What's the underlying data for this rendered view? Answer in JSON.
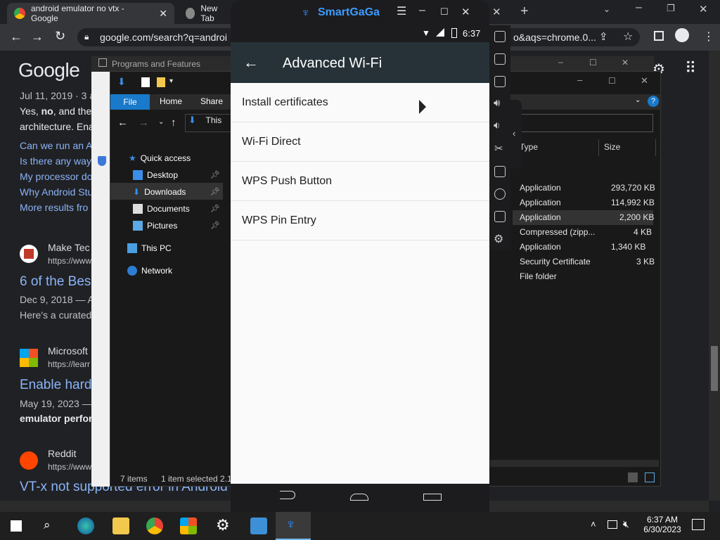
{
  "chrome": {
    "tabs": [
      {
        "label": "android emulator no vtx - Google"
      },
      {
        "label": "New Tab"
      }
    ],
    "url": "google.com/search?q=androi",
    "url_tail": "o&aqs=chrome.0..."
  },
  "google": {
    "logo": "Google",
    "date1": "Jul 11, 2019 · 3 a",
    "snippet_a": "Yes, ",
    "snippet_bold": "no",
    "snippet_b": ", and ther",
    "snippet2": "architecture. Ena",
    "links": [
      "Can we run an A",
      "Is there any way",
      "My processor do",
      "Why Android Stu",
      "More results fro"
    ],
    "results": [
      {
        "site": "Make Tec",
        "url": "https://www",
        "title": "6 of the Bes",
        "date": "Dec 9, 2018 — A",
        "snippet": "Here's a curated"
      },
      {
        "site": "Microsoft",
        "url": "https://learr",
        "title": "Enable hard",
        "date": "May 19, 2023 —",
        "snippet": "emulator perform"
      },
      {
        "site": "Reddit",
        "url": "https://www.re",
        "title": "VT-x not supported error in Android"
      }
    ]
  },
  "programs_features": {
    "title": "Programs and Features"
  },
  "explorer": {
    "ribbon": [
      "File",
      "Home",
      "Share"
    ],
    "address": "This",
    "nav": [
      {
        "label": "Quick access"
      },
      {
        "label": "Desktop"
      },
      {
        "label": "Downloads"
      },
      {
        "label": "Documents"
      },
      {
        "label": "Pictures"
      },
      {
        "label": "This PC"
      },
      {
        "label": "Network"
      }
    ],
    "columns": [
      "Type",
      "Size"
    ],
    "files": [
      {
        "type": "Application",
        "size": "293,720 KB"
      },
      {
        "type": "Application",
        "size": "114,992 KB"
      },
      {
        "type": "Application",
        "size": "2,200 KB"
      },
      {
        "type": "Compressed (zipp...",
        "size": "4 KB"
      },
      {
        "type": "Application",
        "size": "1,340 KB"
      },
      {
        "type": "Security Certificate",
        "size": "3 KB"
      },
      {
        "type": "File folder",
        "size": ""
      }
    ],
    "status_items": "7 items",
    "status_selected": "1 item selected  2.1"
  },
  "emulator": {
    "brand": "SmartGaGa",
    "time": "6:37",
    "title": "Advanced Wi-Fi",
    "items": [
      "Install certificates",
      "Wi-Fi Direct",
      "WPS Push Button",
      "WPS Pin Entry"
    ]
  },
  "taskbar": {
    "time": "6:37 AM",
    "date": "6/30/2023"
  }
}
